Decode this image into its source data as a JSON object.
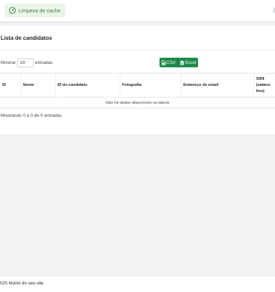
{
  "topbar": {
    "cache_button_label": "Limpeza de cache",
    "cache_icon": "gauge-icon"
  },
  "card": {
    "title": "Lista de candidatos",
    "length": {
      "prefix": "Mostrar",
      "value": "10",
      "suffix": "entradas"
    },
    "export": {
      "csv_label": "CSV",
      "excel_label": "Excel"
    },
    "table": {
      "columns": [
        "Sl",
        "Nome",
        "ID do candidato",
        "Fotografia",
        "Endereço de email",
        "SSN (salário fixo)"
      ],
      "empty_message": "Não há dados disponíveis na tabela"
    },
    "info": "Mostrando 0 a 0 de 0 entradas"
  },
  "footer": {
    "text": "025 Nome do seu site"
  },
  "colors": {
    "accent_green": "#1f8a4c",
    "cache_text": "#3a7d3a",
    "page_bg": "#f2f3f5"
  }
}
